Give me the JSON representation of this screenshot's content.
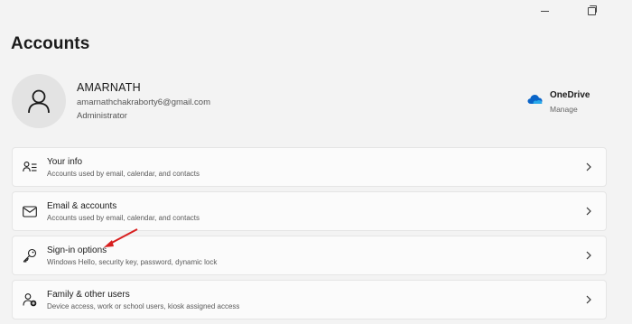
{
  "window": {
    "minimize_icon": "minimize-icon",
    "maximize_icon": "maximize-icon"
  },
  "page": {
    "title": "Accounts"
  },
  "profile": {
    "name": "AMARNATH",
    "email": "amarnathchakraborty6@gmail.com",
    "role": "Administrator",
    "avatar_icon": "person-icon"
  },
  "onedrive": {
    "name": "OneDrive",
    "action": "Manage",
    "icon": "cloud-icon",
    "color": "#0a64c8"
  },
  "items": [
    {
      "title": "Your info",
      "description": "Accounts used by email, calendar, and contacts",
      "icon": "person-card-icon"
    },
    {
      "title": "Email & accounts",
      "description": "Accounts used by email, calendar, and contacts",
      "icon": "mail-icon"
    },
    {
      "title": "Sign-in options",
      "description": "Windows Hello, security key, password, dynamic lock",
      "icon": "key-icon"
    },
    {
      "title": "Family & other users",
      "description": "Device access, work or school users, kiosk assigned access",
      "icon": "family-icon"
    }
  ],
  "annotation": {
    "color": "#d82020",
    "icon": "red-arrow-annotation"
  }
}
